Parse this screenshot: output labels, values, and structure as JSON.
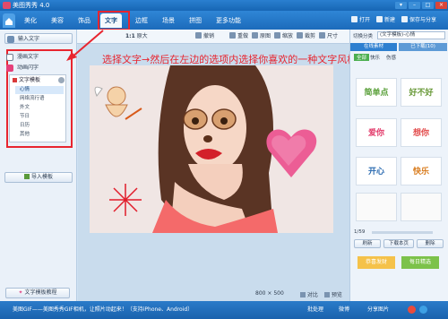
{
  "window": {
    "title": "美图秀秀 4.0"
  },
  "menu": {
    "tabs": [
      "美化",
      "美容",
      "饰品",
      "文字",
      "边框",
      "场景",
      "拼图",
      "更多功能"
    ],
    "active_tab": "文字",
    "right_buttons": [
      "打开",
      "新建",
      "保存与分享"
    ]
  },
  "toolbar": {
    "items": [
      "1:1",
      "原大",
      "撤销",
      "重做",
      "原图",
      "缩放",
      "裁剪",
      "尺寸"
    ]
  },
  "left_panel": {
    "input_text": "输入文字",
    "long_text": "漫画文字",
    "animated_text": "动画闪字",
    "text_templates": "文字模板",
    "template_items": [
      "心情",
      "网络流行语",
      "外文",
      "节日",
      "日历",
      "其他"
    ],
    "selected_template": "心情",
    "import_template": "导入模板",
    "tutorial_button": "文字模板教程"
  },
  "canvas": {
    "size_w": "800",
    "size_x": "×",
    "size_h": "500",
    "compare_label": "对比",
    "preview_label": "预览"
  },
  "annotation": {
    "text": "选择文字→然后在左边的选项内选择你喜欢的一种文字风格"
  },
  "right_panel": {
    "category_label": "切换分类",
    "category_value": "(文字模板)-心情",
    "tabs": [
      "在线素材",
      "已下载(10)"
    ],
    "filters": [
      "全部",
      "快乐",
      "伤感"
    ],
    "stickers": [
      "简单点",
      "好不好",
      "爱你",
      "想你",
      "开心",
      "快乐"
    ],
    "page_indicator": "1/59",
    "actions": [
      "刷新",
      "下载本页",
      "删除"
    ],
    "bottom_tags": [
      "恭喜发财",
      "每日精选"
    ]
  },
  "status_bar": {
    "text": "美图GIF——美图秀秀GIF相机，让照片动起来！（支持iPhone、Android）",
    "right_items": [
      "批处理",
      "微博",
      "分享图片"
    ]
  },
  "colors": {
    "accent": "#1c6bbb",
    "highlight": "#e8252f",
    "active_tab_bg": "#f4f8fc"
  }
}
